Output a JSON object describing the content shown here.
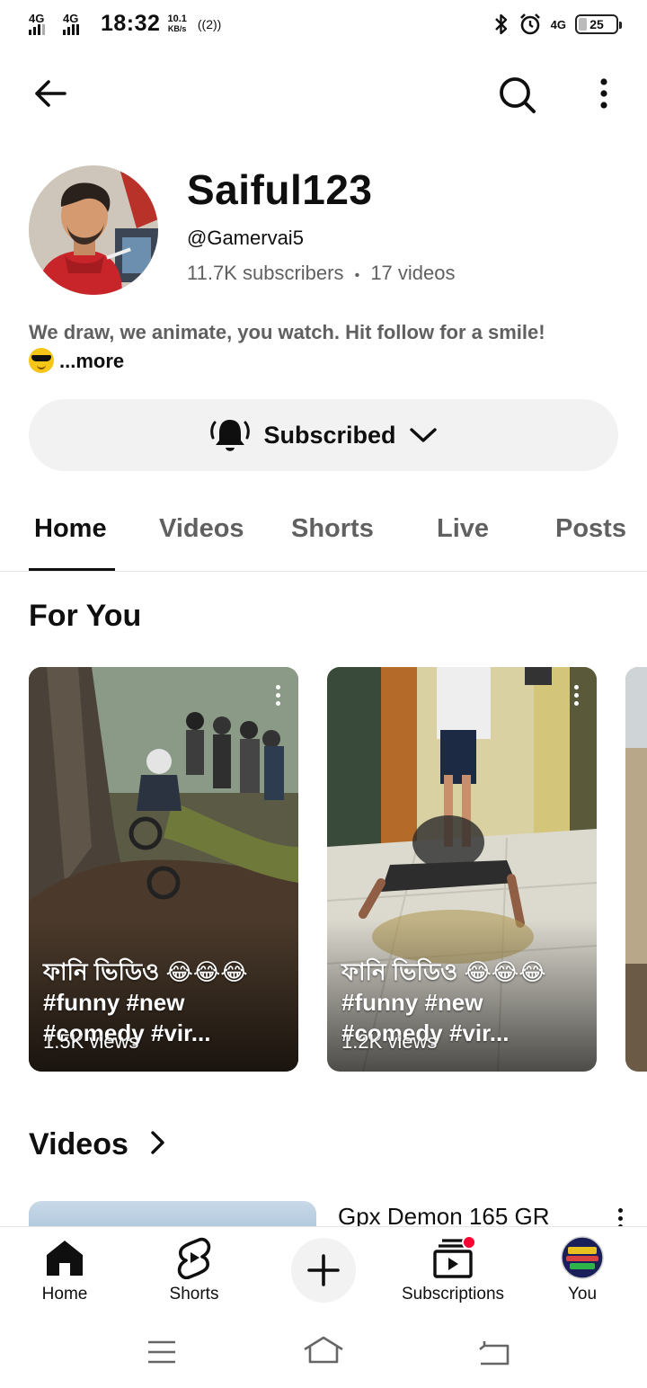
{
  "status_bar": {
    "network1": "4G",
    "network2": "4G",
    "time": "18:32",
    "speed_value": "10.1",
    "speed_unit": "KB/s",
    "hotspot": "((2))",
    "network_right": "4G",
    "battery": "25"
  },
  "channel": {
    "name": "Saiful123",
    "handle": "@Gamervai5",
    "subscribers": "11.7K subscribers",
    "separator": "•",
    "videos": "17 videos",
    "description": "We draw, we animate, you watch. Hit follow for a smile!",
    "more_label": "...more"
  },
  "subscribe_button": {
    "label": "Subscribed"
  },
  "tabs": [
    {
      "label": "Home",
      "active": true
    },
    {
      "label": "Videos",
      "active": false
    },
    {
      "label": "Shorts",
      "active": false
    },
    {
      "label": "Live",
      "active": false
    },
    {
      "label": "Posts",
      "active": false
    }
  ],
  "for_you": {
    "title": "For You",
    "shorts": [
      {
        "title": "ফানি ভিডিও 😂😂😂 #funny #new #comedy #vir...",
        "views": "1.5K views"
      },
      {
        "title": "ফানি ভিডিও 😂😂😂 #funny #new #comedy #vir...",
        "views": "1.2K views"
      }
    ]
  },
  "videos_section": {
    "title": "Videos",
    "first_video_title": "Gpx Demon 165 GR"
  },
  "bottom_nav": {
    "home": "Home",
    "shorts": "Shorts",
    "subscriptions": "Subscriptions",
    "you": "You"
  },
  "icons": {
    "back": "back-arrow-icon",
    "search": "search-icon",
    "more": "more-vertical-icon",
    "bell": "bell-ringing-icon",
    "chevron": "chevron-down-icon",
    "create": "plus-icon"
  },
  "colors": {
    "text_primary": "#0f0f0f",
    "text_secondary": "#606060",
    "chip_bg": "#f2f2f2",
    "notification_dot": "#ff0033"
  }
}
